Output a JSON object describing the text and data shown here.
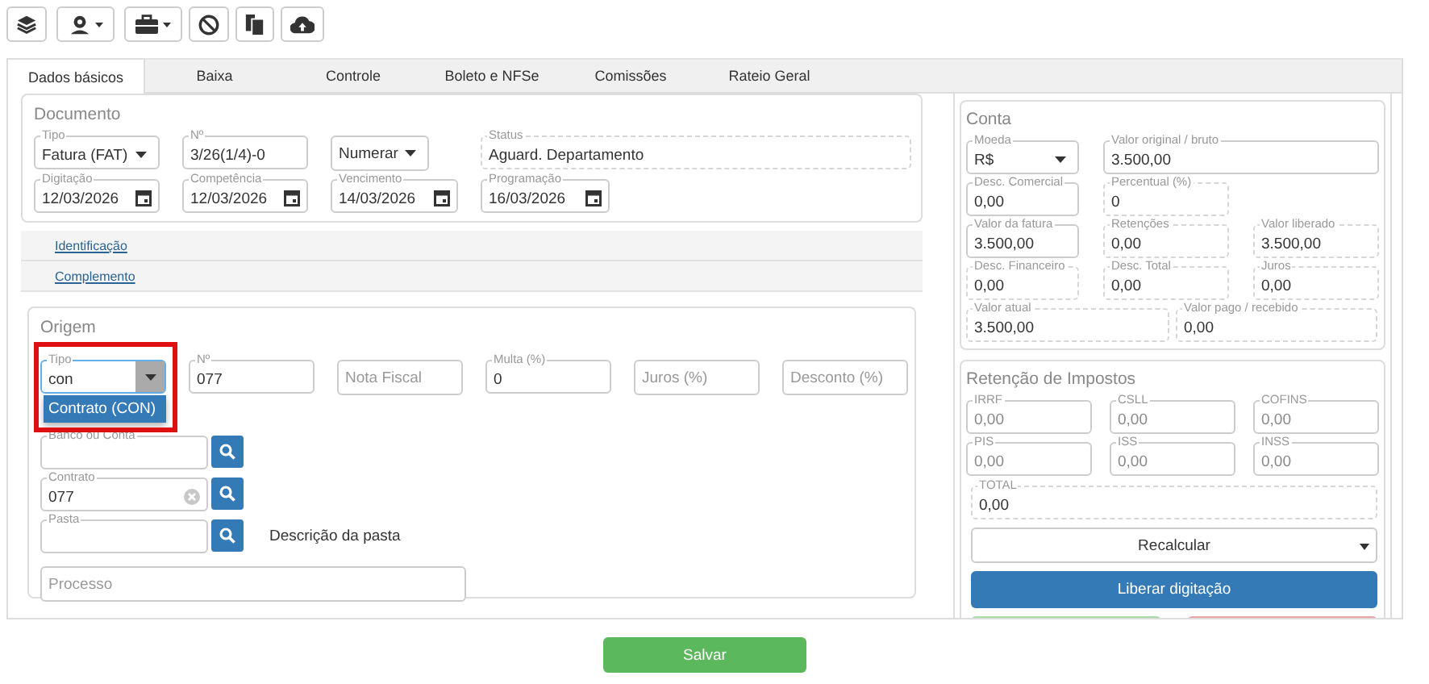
{
  "toolbar": [
    {
      "dropdown": false
    },
    {
      "dropdown": true
    },
    {
      "dropdown": true
    },
    {
      "dropdown": false
    },
    {
      "dropdown": false
    },
    {
      "dropdown": false
    }
  ],
  "tabs": [
    {
      "label": "Dados básicos",
      "selected": true
    },
    {
      "label": "Baixa",
      "selected": false
    },
    {
      "label": "Controle",
      "selected": false
    },
    {
      "label": "Boleto e NFSe",
      "selected": false
    },
    {
      "label": "Comissões",
      "selected": false
    },
    {
      "label": "Rateio Geral",
      "selected": false
    }
  ],
  "documento": {
    "title": "Documento",
    "rows": [
      [
        {
          "label": "Tipo",
          "value": "Fatura (FAT)",
          "kind": "select",
          "readonly": false
        },
        {
          "label": "Nº",
          "value": "3/26(1/4)-0",
          "kind": "text",
          "readonly": false
        },
        {
          "value": "Numerar",
          "kind": "select",
          "readonly": false
        },
        {
          "label": "Status",
          "value": "Aguard. Departamento",
          "kind": "text",
          "readonly": true
        }
      ],
      [
        {
          "label": "Digitação",
          "value": "12/03/2026",
          "kind": "date",
          "readonly": false
        },
        {
          "label": "Competência",
          "value": "12/03/2026",
          "kind": "date",
          "readonly": false
        },
        {
          "label": "Vencimento",
          "value": "14/03/2026",
          "kind": "date",
          "readonly": false
        },
        {
          "label": "Programação",
          "value": "16/03/2026",
          "kind": "date",
          "readonly": false
        }
      ]
    ]
  },
  "sections": [
    {
      "label": "Identificação"
    },
    {
      "label": "Complemento"
    }
  ],
  "origem": {
    "title": "Origem",
    "tipo": {
      "label": "Tipo",
      "value": "con",
      "kind": "combo",
      "readonly": false,
      "focused": true,
      "highlighted": true,
      "options": [
        {
          "label": "Contrato (CON)",
          "selected": true
        }
      ]
    },
    "fields": [
      {
        "label": "Nº",
        "value": "077",
        "kind": "text",
        "readonly": false
      },
      {
        "placeholder": "Nota Fiscal",
        "kind": "text",
        "readonly": false
      },
      {
        "label": "Multa (%)",
        "value": "0",
        "kind": "text",
        "readonly": false
      },
      {
        "placeholder": "Juros (%)",
        "kind": "text",
        "readonly": false
      },
      {
        "placeholder": "Desconto (%)",
        "kind": "text",
        "readonly": false
      }
    ],
    "lookups": [
      {
        "label": "Banco ou Conta",
        "kind": "lookup",
        "readonly": false
      },
      {
        "label": "Contrato",
        "value": "077",
        "kind": "lookup-clear",
        "readonly": false
      },
      {
        "label": "Pasta",
        "kind": "lookup",
        "readonly": false,
        "description": "Descrição da pasta"
      }
    ],
    "processo": {
      "placeholder": "Processo",
      "kind": "text",
      "readonly": false
    }
  },
  "conta": {
    "title": "Conta",
    "rows": [
      [
        {
          "label": "Moeda",
          "value": "R$",
          "kind": "select",
          "readonly": false
        },
        {
          "label": "Valor original / bruto",
          "value": "3.500,00",
          "kind": "text",
          "readonly": false
        }
      ],
      [
        {
          "label": "Desc. Comercial",
          "value": "0,00",
          "kind": "text",
          "readonly": false
        },
        {
          "label": "Percentual (%)",
          "value": "0",
          "kind": "text",
          "readonly": true
        }
      ],
      [
        {
          "label": "Valor da fatura",
          "value": "3.500,00",
          "kind": "text",
          "readonly": false
        },
        {
          "label": "Retenções",
          "value": "0,00",
          "kind": "text",
          "readonly": true
        },
        {
          "label": "Valor liberado",
          "value": "3.500,00",
          "kind": "text",
          "readonly": true
        }
      ],
      [
        {
          "label": "Desc. Financeiro",
          "value": "0,00",
          "kind": "text",
          "readonly": true
        },
        {
          "label": "Desc. Total",
          "value": "0,00",
          "kind": "text",
          "readonly": true
        },
        {
          "label": "Juros",
          "value": "0,00",
          "kind": "text",
          "readonly": true
        }
      ],
      [
        {
          "label": "Valor atual",
          "value": "3.500,00",
          "kind": "text",
          "readonly": true
        },
        {
          "label": "Valor pago / recebido",
          "value": "0,00",
          "kind": "text",
          "readonly": true
        }
      ]
    ]
  },
  "retencao": {
    "title": "Retenção de Impostos",
    "rows": [
      [
        {
          "label": "IRRF",
          "value": "0,00",
          "kind": "text",
          "readonly": false,
          "disabled": true
        },
        {
          "label": "CSLL",
          "value": "0,00",
          "kind": "text",
          "readonly": false,
          "disabled": true
        },
        {
          "label": "COFINS",
          "value": "0,00",
          "kind": "text",
          "readonly": false,
          "disabled": true
        }
      ],
      [
        {
          "label": "PIS",
          "value": "0,00",
          "kind": "text",
          "readonly": false,
          "disabled": true
        },
        {
          "label": "ISS",
          "value": "0,00",
          "kind": "text",
          "readonly": false,
          "disabled": true
        },
        {
          "label": "INSS",
          "value": "0,00",
          "kind": "text",
          "readonly": false,
          "disabled": true
        }
      ]
    ],
    "total": {
      "label": "TOTAL",
      "value": "0,00",
      "kind": "text",
      "readonly": true,
      "disabled": false
    },
    "recalcular": "Recalcular",
    "liberar": "Liberar digitação"
  },
  "salvar": "Salvar"
}
